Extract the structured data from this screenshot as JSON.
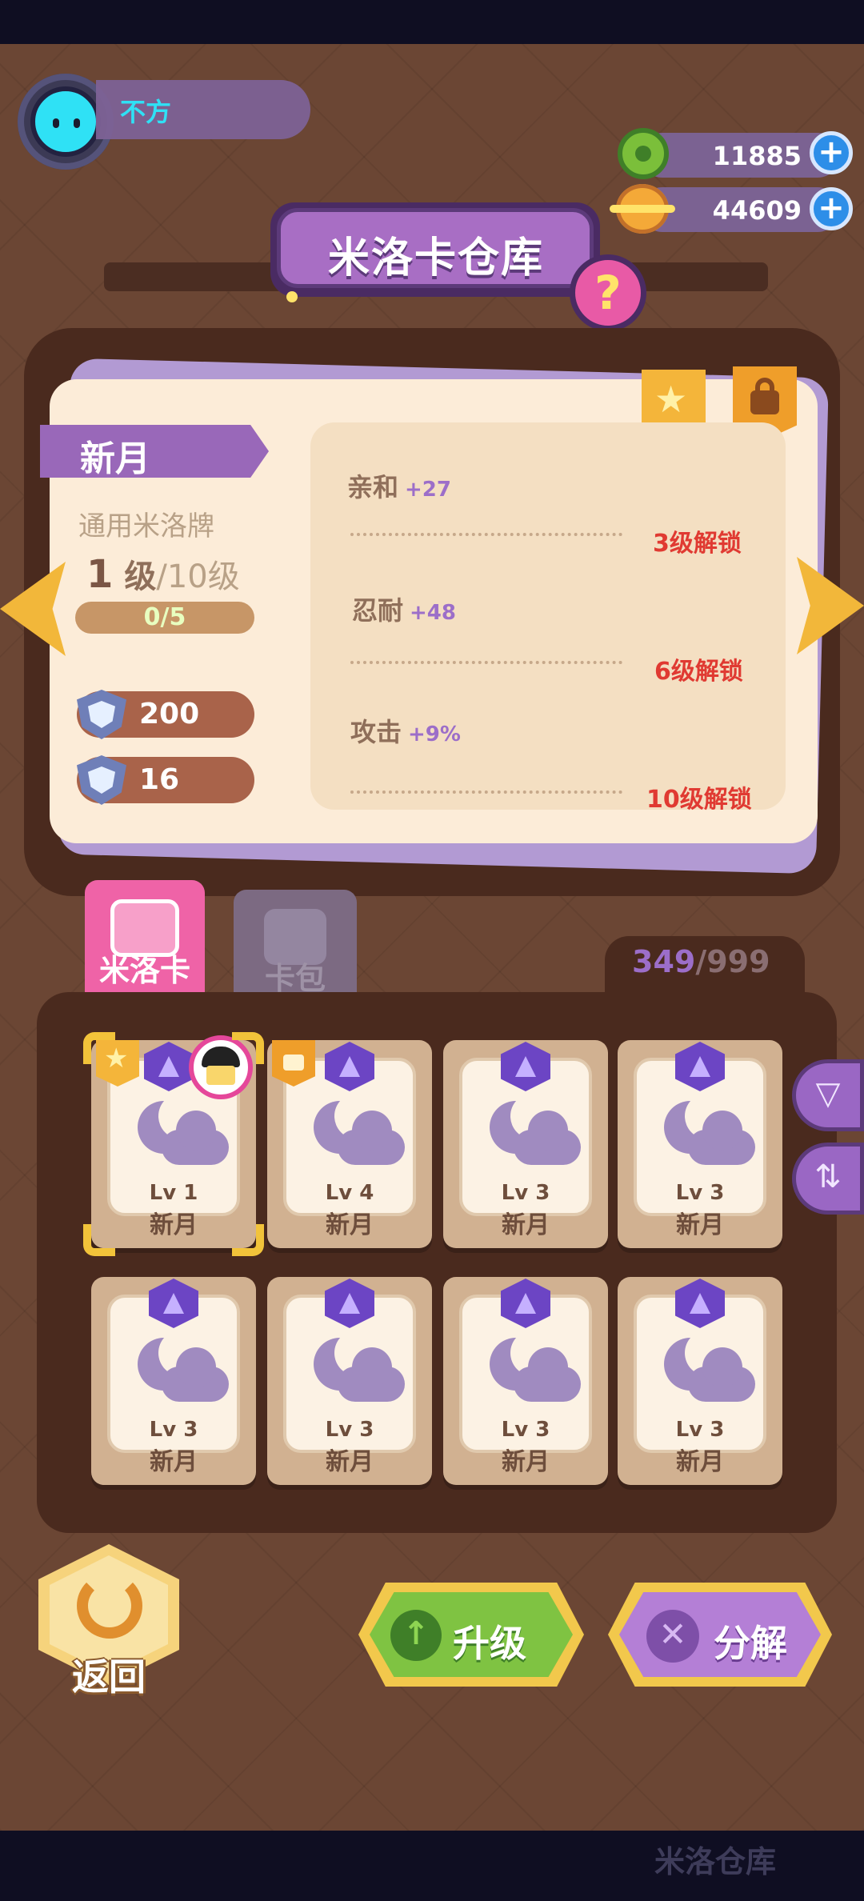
{
  "player": {
    "name": "不方"
  },
  "currency": [
    {
      "icon": "green-donut-coin-icon",
      "amount": "11885"
    },
    {
      "icon": "gold-planet-coin-icon",
      "amount": "44609"
    }
  ],
  "title": "米洛卡仓库",
  "help_label": "?",
  "card": {
    "name": "新月",
    "type": "通用米洛牌",
    "level_current": "1",
    "level_current_suffix": "级",
    "level_max": "/10级",
    "exp_text": "0/5",
    "exp_fraction": 0,
    "stats": [
      {
        "icon": "heart-shield-icon",
        "value": "200"
      },
      {
        "icon": "shield-icon",
        "value": "16"
      }
    ],
    "attributes": [
      {
        "name": "亲和",
        "bonus": "+27",
        "unlock": "3级解锁"
      },
      {
        "name": "忍耐",
        "bonus": "+48",
        "unlock": "6级解锁"
      },
      {
        "name": "攻击",
        "bonus": "+9%",
        "unlock": "10级解锁"
      }
    ]
  },
  "tabs": [
    {
      "label": "米洛卡",
      "active": true
    },
    {
      "label": "卡包",
      "active": false
    }
  ],
  "inventory": {
    "count": "349",
    "capacity": "/999",
    "items": [
      {
        "level": "Lv 1",
        "name": "新月",
        "selected": true,
        "starred": true,
        "locked": false,
        "equipped": true
      },
      {
        "level": "Lv 4",
        "name": "新月",
        "selected": false,
        "starred": false,
        "locked": true,
        "equipped": false
      },
      {
        "level": "Lv 3",
        "name": "新月",
        "selected": false,
        "starred": false,
        "locked": false,
        "equipped": false
      },
      {
        "level": "Lv 3",
        "name": "新月",
        "selected": false,
        "starred": false,
        "locked": false,
        "equipped": false
      },
      {
        "level": "Lv 3",
        "name": "新月",
        "selected": false,
        "starred": false,
        "locked": false,
        "equipped": false
      },
      {
        "level": "Lv 3",
        "name": "新月",
        "selected": false,
        "starred": false,
        "locked": false,
        "equipped": false
      },
      {
        "level": "Lv 3",
        "name": "新月",
        "selected": false,
        "starred": false,
        "locked": false,
        "equipped": false
      },
      {
        "level": "Lv 3",
        "name": "新月",
        "selected": false,
        "starred": false,
        "locked": false,
        "equipped": false
      }
    ]
  },
  "buttons": {
    "back": "返回",
    "upgrade": "升级",
    "disassemble": "分解"
  },
  "bottom_nav": {
    "ghost_label": "米洛仓库"
  }
}
